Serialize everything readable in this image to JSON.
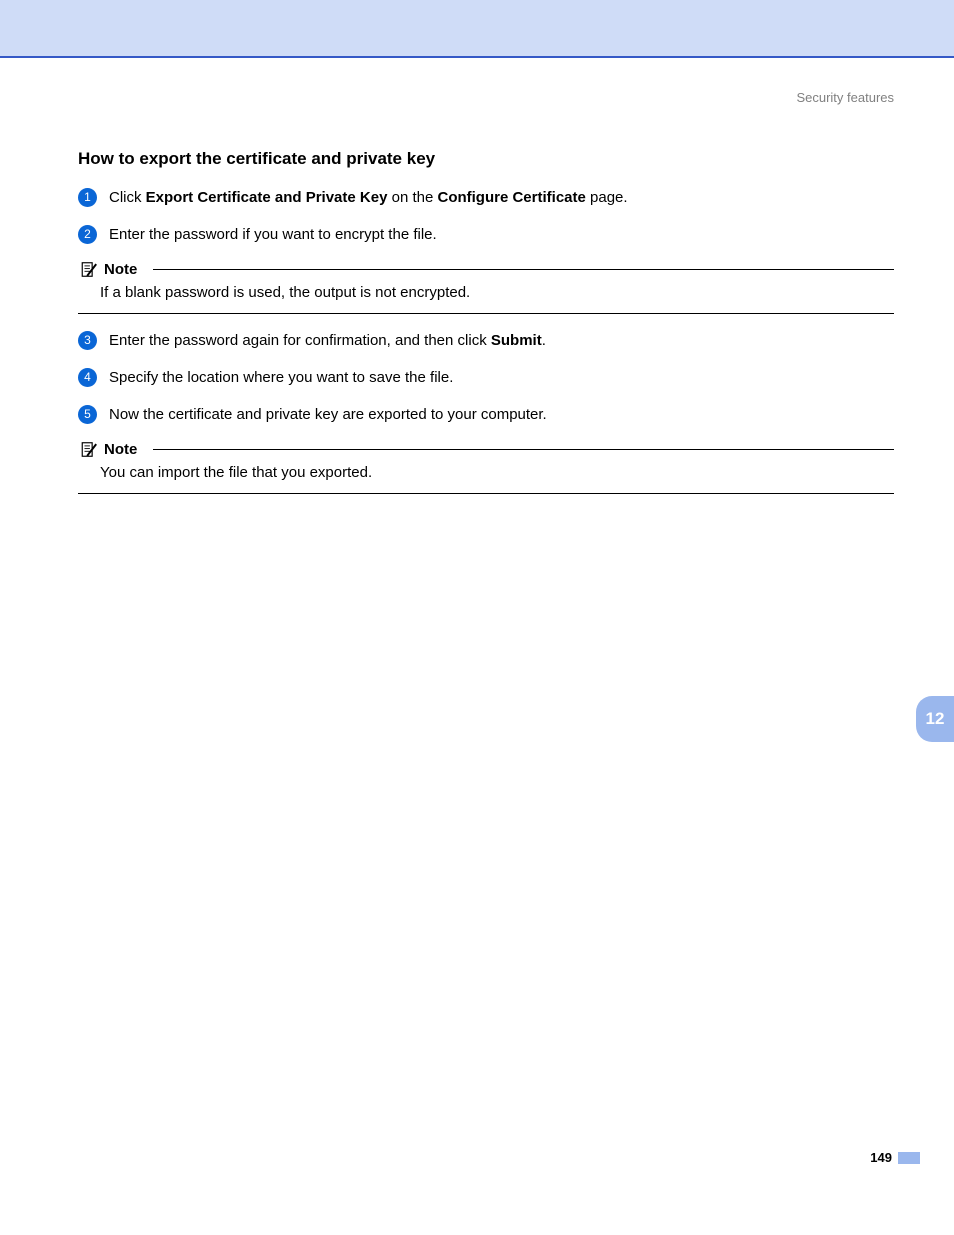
{
  "header": {
    "label": "Security features"
  },
  "title": "How to export the certificate and private key",
  "steps": {
    "s1": {
      "num": "1",
      "seg1": "Click ",
      "b1": "Export Certificate and Private Key",
      "seg2": " on the ",
      "b2": "Configure Certificate",
      "seg3": " page."
    },
    "s2": {
      "num": "2",
      "text": "Enter the password if you want to encrypt the file."
    },
    "s3": {
      "num": "3",
      "seg1": "Enter the password again for confirmation, and then click ",
      "b1": "Submit",
      "seg2": "."
    },
    "s4": {
      "num": "4",
      "text": "Specify the location where you want to save the file."
    },
    "s5": {
      "num": "5",
      "text": "Now the certificate and private key are exported to your computer."
    }
  },
  "notes": {
    "label": "Note",
    "n1": "If a blank password is used, the output is not encrypted.",
    "n2": "You can import the file that you exported."
  },
  "chapter": "12",
  "page_number": "149"
}
